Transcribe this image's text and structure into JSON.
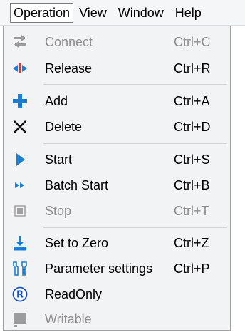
{
  "menubar": {
    "items": [
      {
        "label": "Operation",
        "active": true
      },
      {
        "label": "View"
      },
      {
        "label": "Window"
      },
      {
        "label": "Help"
      }
    ]
  },
  "menu": {
    "items": [
      {
        "label": "Connect",
        "shortcut": "Ctrl+C",
        "icon": "connect-icon",
        "enabled": false
      },
      {
        "label": "Release",
        "shortcut": "Ctrl+R",
        "icon": "release-icon",
        "enabled": true
      },
      {
        "label": "Add",
        "shortcut": "Ctrl+A",
        "icon": "add-icon",
        "enabled": true
      },
      {
        "label": "Delete",
        "shortcut": "Ctrl+D",
        "icon": "delete-icon",
        "enabled": true
      },
      {
        "label": "Start",
        "shortcut": "Ctrl+S",
        "icon": "start-icon",
        "enabled": true
      },
      {
        "label": "Batch Start",
        "shortcut": "Ctrl+B",
        "icon": "batch-start-icon",
        "enabled": true
      },
      {
        "label": "Stop",
        "shortcut": "Ctrl+T",
        "icon": "stop-icon",
        "enabled": false
      },
      {
        "label": "Set to Zero",
        "shortcut": "Ctrl+Z",
        "icon": "set-to-zero-icon",
        "enabled": true
      },
      {
        "label": "Parameter settings",
        "shortcut": "Ctrl+P",
        "icon": "wrench-icon",
        "enabled": true
      },
      {
        "label": "ReadOnly",
        "shortcut": "",
        "icon": "readonly-icon",
        "enabled": true
      },
      {
        "label": "Writable",
        "shortcut": "",
        "icon": "writable-icon",
        "enabled": false
      }
    ]
  },
  "colors": {
    "accent_blue": "#1a7fd4",
    "disabled_gray": "#8e8e8e",
    "menu_background": "#f2f3f5"
  }
}
